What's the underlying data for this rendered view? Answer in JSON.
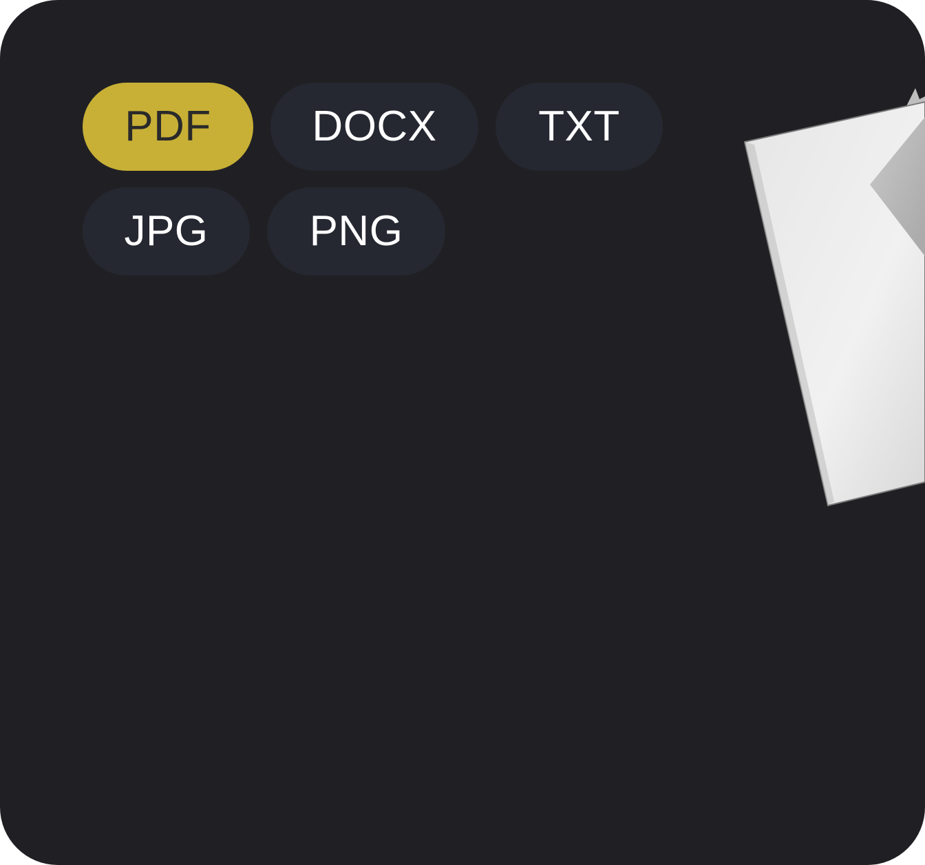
{
  "format_selector": {
    "options": [
      {
        "label": "PDF",
        "selected": true
      },
      {
        "label": "DOCX",
        "selected": false
      },
      {
        "label": "TXT",
        "selected": false
      },
      {
        "label": "JPG",
        "selected": false
      },
      {
        "label": "PNG",
        "selected": false
      }
    ]
  },
  "colors": {
    "background": "#202024",
    "chip_bg": "#252731",
    "chip_selected_bg": "#c8b036",
    "chip_text": "#ffffff",
    "chip_selected_text": "#2a2a2a"
  },
  "illustration": {
    "icon": "document-paper-icon"
  }
}
